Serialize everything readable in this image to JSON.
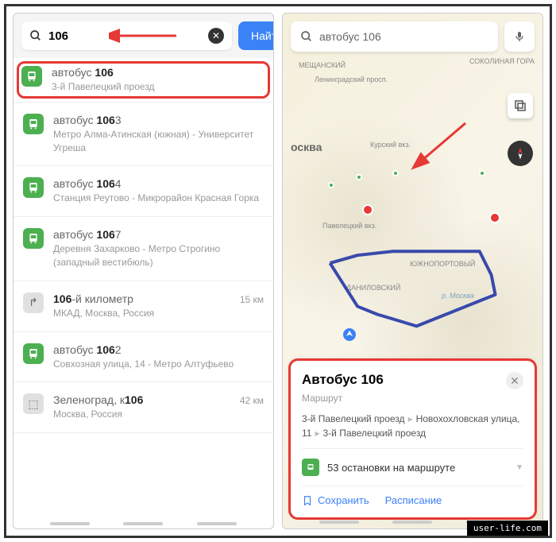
{
  "left": {
    "search": {
      "value": "106",
      "button": "Найти"
    },
    "results": [
      {
        "type": "bus",
        "prefix": "автобус ",
        "bold": "106",
        "sub": "3-й Павелецкий проезд",
        "highlighted": true
      },
      {
        "type": "bus",
        "prefix": "автобус ",
        "bold": "106",
        "suffix": "3",
        "sub": "Метро Алма-Атинская (южная) - Университет Угреша"
      },
      {
        "type": "bus",
        "prefix": "автобус ",
        "bold": "106",
        "suffix": "4",
        "sub": "Станция Реутово - Микрорайон Красная Горка"
      },
      {
        "type": "bus",
        "prefix": "автобус ",
        "bold": "106",
        "suffix": "7",
        "sub": "Деревня Захарково - Метро Строгино (западный вестибюль)"
      },
      {
        "type": "place",
        "bold": "106",
        "suffix": "-й километр",
        "sub": "МКАД, Москва, Россия",
        "dist": "15 км"
      },
      {
        "type": "bus",
        "prefix": "автобус ",
        "bold": "106",
        "suffix": "2",
        "sub": "Совхозная улица, 14 - Метро Алтуфьево"
      },
      {
        "type": "place",
        "prefix": "Зеленоград, к",
        "bold": "106",
        "sub": "Москва, Россия",
        "dist": "42 км"
      }
    ]
  },
  "right": {
    "search": "автобус 106",
    "map_labels": {
      "moscow": "осква",
      "mesh": "МЕЩАНСКИЙ",
      "lenin": "Ленинградский просп.",
      "kursk": "Курский вкз.",
      "pavel": "Павелецкий вкз.",
      "yuzh": "ЮЖНОПОРТОВЫЙ",
      "danil": "ДАНИЛОВСКИЙ",
      "reka": "р. Москва",
      "sokol": "СОКОЛИНАЯ ГОРА"
    },
    "card": {
      "title": "Автобус 106",
      "subtitle": "Маршрут",
      "route1": "3-й Павелецкий проезд",
      "route2": "Новохохловская улица, 11",
      "route3": "3-й Павелецкий проезд",
      "stops": "53 остановки на маршруте",
      "save": "Сохранить",
      "schedule": "Расписание"
    }
  },
  "watermark": "user-life.com"
}
